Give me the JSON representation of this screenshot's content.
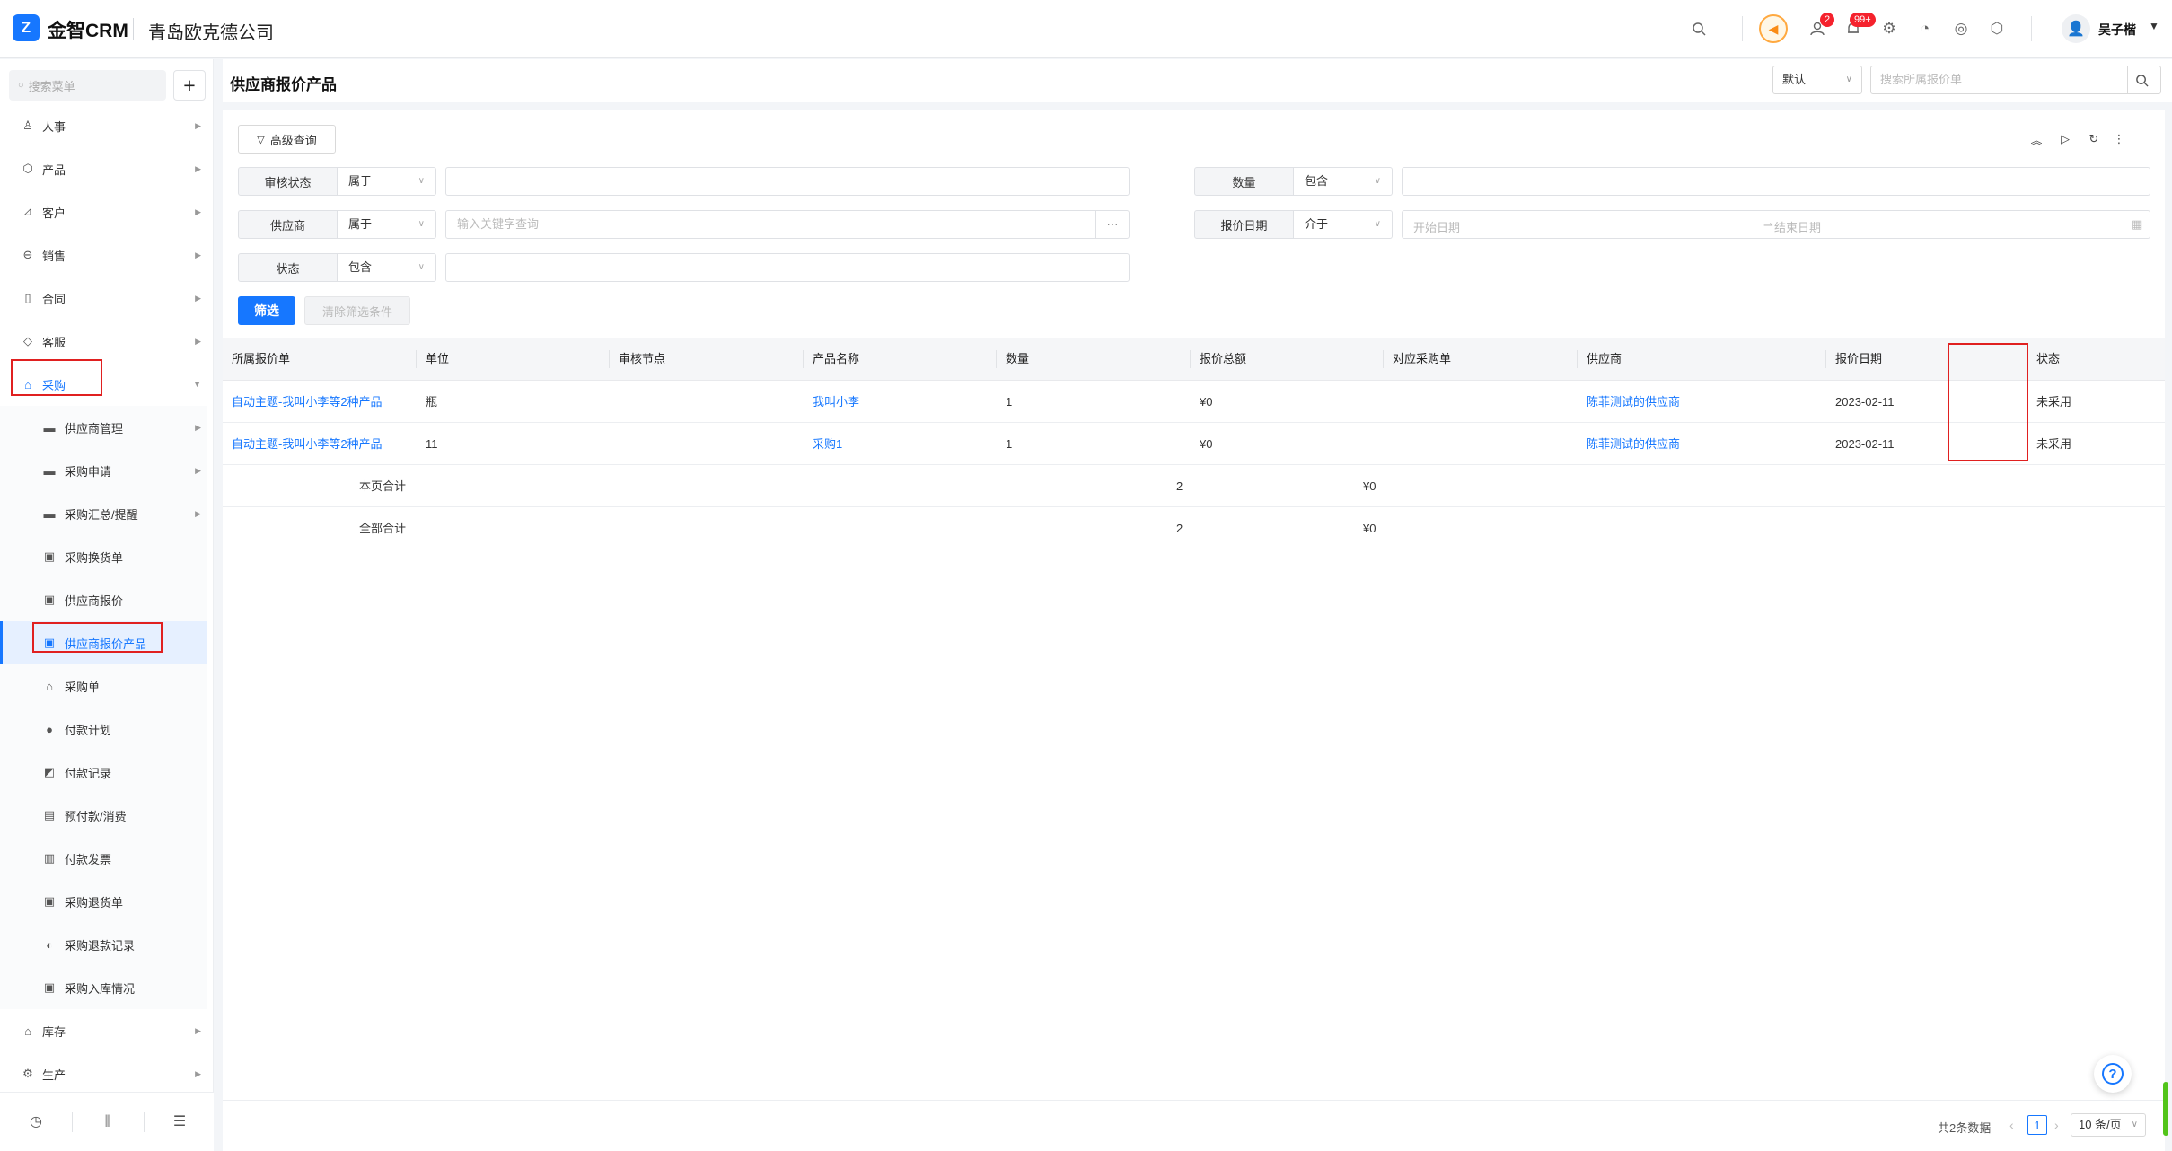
{
  "header": {
    "logo_mark": "Z",
    "app_name": "金智CRM",
    "company": "青岛欧克德公司",
    "contacts_badge": "2",
    "notify_badge": "99+",
    "username": "吴子楷"
  },
  "sidebar": {
    "search_placeholder": "搜索菜单",
    "add_label": "+",
    "items": [
      {
        "label": "人事",
        "icon": "person-icon",
        "glyph": "♙"
      },
      {
        "label": "产品",
        "icon": "cube-icon",
        "glyph": "⬡"
      },
      {
        "label": "客户",
        "icon": "customer-icon",
        "glyph": "⊿"
      },
      {
        "label": "销售",
        "icon": "sales-icon",
        "glyph": "⊖"
      },
      {
        "label": "合同",
        "icon": "contract-icon",
        "glyph": "▯"
      },
      {
        "label": "客服",
        "icon": "service-icon",
        "glyph": "◇"
      },
      {
        "label": "采购",
        "icon": "purchase-icon",
        "glyph": "⌂"
      }
    ],
    "purchase_children": [
      {
        "label": "供应商管理",
        "glyph": "▬",
        "arrow": true
      },
      {
        "label": "采购申请",
        "glyph": "▬",
        "arrow": true
      },
      {
        "label": "采购汇总/提醒",
        "glyph": "▬",
        "arrow": true
      },
      {
        "label": "采购换货单",
        "glyph": "▣",
        "arrow": false
      },
      {
        "label": "供应商报价",
        "glyph": "▣",
        "arrow": false
      },
      {
        "label": "供应商报价产品",
        "glyph": "▣",
        "arrow": false
      },
      {
        "label": "采购单",
        "glyph": "⌂",
        "arrow": false
      },
      {
        "label": "付款计划",
        "glyph": "●",
        "arrow": false
      },
      {
        "label": "付款记录",
        "glyph": "◩",
        "arrow": false
      },
      {
        "label": "预付款/消费",
        "glyph": "▤",
        "arrow": false
      },
      {
        "label": "付款发票",
        "glyph": "▥",
        "arrow": false
      },
      {
        "label": "采购退货单",
        "glyph": "▣",
        "arrow": false
      },
      {
        "label": "采购退款记录",
        "glyph": "◐",
        "arrow": false
      },
      {
        "label": "采购入库情况",
        "glyph": "▣",
        "arrow": false
      }
    ],
    "after_items": [
      {
        "label": "库存",
        "glyph": "⌂"
      },
      {
        "label": "生产",
        "glyph": "⚙"
      }
    ]
  },
  "page": {
    "title": "供应商报价产品",
    "view_select": "默认",
    "search_placeholder": "搜索所属报价单"
  },
  "filters": {
    "advanced_label": "高级查询",
    "rows": [
      {
        "label": "审核状态",
        "op": "属于",
        "value": ""
      },
      {
        "label": "供应商",
        "op": "属于",
        "placeholder": "输入关键字查询"
      },
      {
        "label": "状态",
        "op": "包含",
        "value": ""
      }
    ],
    "right_rows": [
      {
        "label": "数量",
        "op": "包含",
        "value": ""
      },
      {
        "label": "报价日期",
        "op": "介于",
        "start_placeholder": "开始日期",
        "end_placeholder": "结束日期"
      }
    ],
    "dots": "···",
    "arrow": "⇀",
    "apply_label": "筛选",
    "clear_label": "清除筛选条件"
  },
  "table": {
    "columns": [
      "所属报价单",
      "单位",
      "审核节点",
      "产品名称",
      "数量",
      "报价总额",
      "对应采购单",
      "供应商",
      "报价日期",
      "状态"
    ],
    "rows": [
      [
        "自动主题-我叫小李等2种产品",
        "瓶",
        "",
        "我叫小李",
        "1",
        "¥0",
        "",
        "陈菲测试的供应商",
        "2023-02-11",
        "未采用"
      ],
      [
        "自动主题-我叫小李等2种产品",
        "11",
        "",
        "采购1",
        "1",
        "¥0",
        "",
        "陈菲测试的供应商",
        "2023-02-11",
        "未采用"
      ]
    ],
    "page_total": {
      "label": "本页合计",
      "qty": "2",
      "amount": "¥0"
    },
    "all_total": {
      "label": "全部合计",
      "qty": "2",
      "amount": "¥0"
    }
  },
  "pager": {
    "total_text": "共2条数据",
    "current_page": "1",
    "page_size": "10 条/页"
  },
  "colors": {
    "accent": "#1677ff",
    "highlight_box": "#e02020",
    "speaker": "#fa8c16"
  }
}
